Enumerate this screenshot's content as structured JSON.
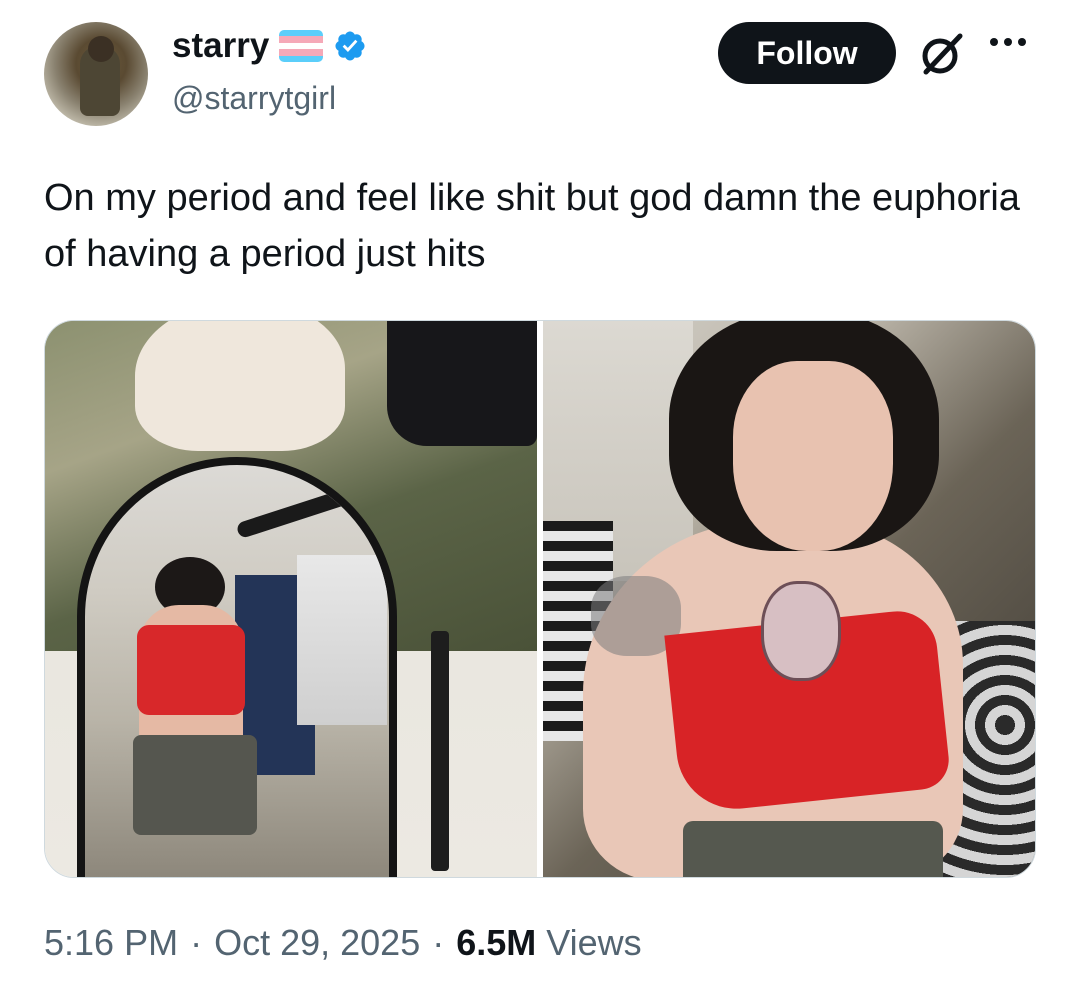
{
  "author": {
    "display_name": "starry",
    "handle": "@starrytgirl",
    "flag_colors": [
      "#5BCEFA",
      "#F5A9B8",
      "#FFFFFF",
      "#F5A9B8",
      "#5BCEFA"
    ],
    "verified_color": "#1D9BF0",
    "avatar_icon": "profile-photo"
  },
  "actions": {
    "follow_label": "Follow",
    "grok_icon": "grok-icon",
    "more_icon": "more-dots-icon"
  },
  "tweet": {
    "text": "On my period and feel like shit but god damn the euphoria of having a period just hits"
  },
  "media": {
    "count": 2,
    "items": [
      "photo",
      "photo"
    ]
  },
  "meta": {
    "time": "5:16 PM",
    "date": "Oct 29, 2025",
    "views_count": "6.5M",
    "views_label": "Views",
    "separator": "·"
  },
  "colors": {
    "text_primary": "#0f1419",
    "text_secondary": "#536471",
    "button_bg": "#0f1419"
  }
}
